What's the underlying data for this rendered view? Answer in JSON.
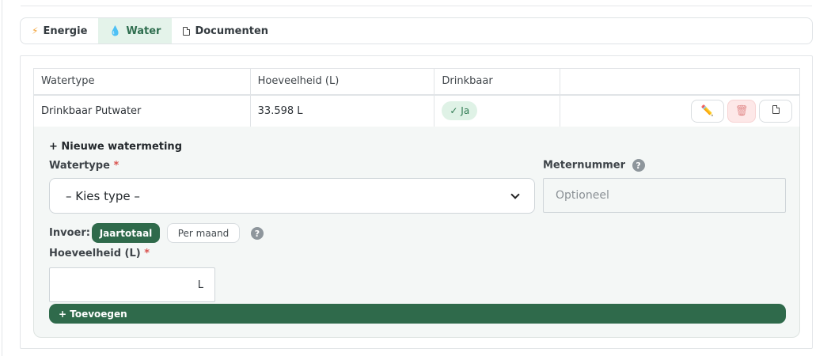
{
  "tabs": [
    {
      "label": "Energie",
      "icon": "lightning-icon"
    },
    {
      "label": "Water",
      "icon": "water-drop-icon",
      "active": true
    },
    {
      "label": "Documenten",
      "icon": "document-icon"
    }
  ],
  "table": {
    "headers": [
      "Watertype",
      "Hoeveelheid (L)",
      "Drinkbaar",
      ""
    ],
    "rows": [
      {
        "watertype": "Drinkbaar Putwater",
        "hoeveelheid": "33.598 L",
        "drinkbaar": "✓ Ja"
      }
    ],
    "action_icons": [
      "pencil-icon",
      "trash-icon",
      "document-icon"
    ]
  },
  "form": {
    "title": "+ Nieuwe watermeting",
    "watertype_label": "Watertype",
    "required_mark": "*",
    "select_value": "– Kies type –",
    "meternummer_label": "Meternummer",
    "meternummer_placeholder": "Optioneel",
    "help_glyph": "?",
    "invoer_label": "Invoer:",
    "invoer_options": [
      "Jaartotaal",
      "Per maand"
    ],
    "invoer_selected": "Jaartotaal",
    "hoeveelheid_label": "Hoeveelheid (L)",
    "unit": "L",
    "add_button": "+ Toevoegen"
  },
  "colors": {
    "primary": "#2f6a4b",
    "tab_active_bg": "#e4f3ea",
    "badge_bg": "#dff2e6",
    "danger_bg": "#fde8e8",
    "required": "#d9534f"
  }
}
